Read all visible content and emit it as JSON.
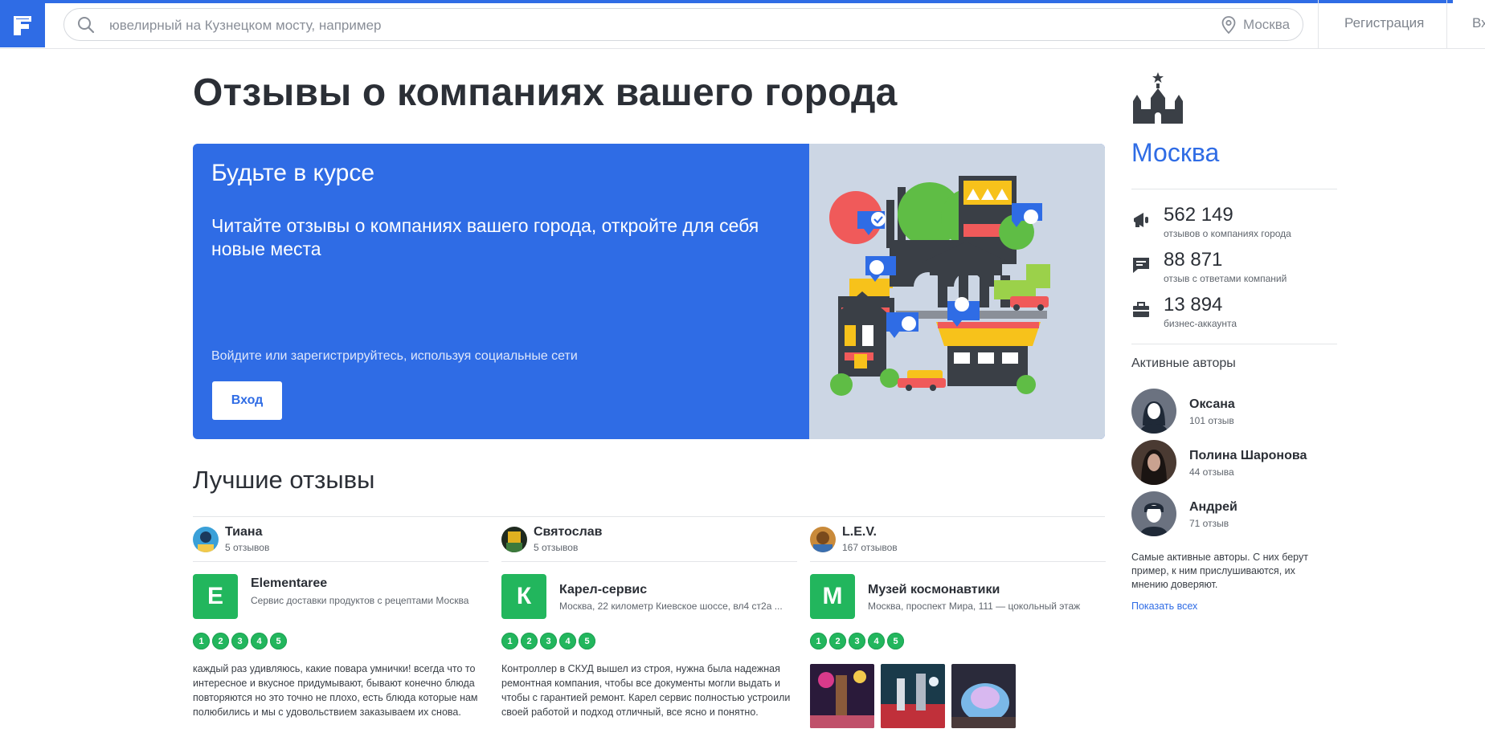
{
  "header": {
    "search_placeholder": "ювелирный на Кузнецком мосту, например",
    "city": "Москва",
    "register": "Регистрация",
    "login": "Вх"
  },
  "page": {
    "title": "Отзывы о компаниях вашего города"
  },
  "banner": {
    "title": "Будьте в курсе",
    "text": "Читайте отзывы о компаниях вашего города, откройте для себя новые места",
    "social": "Войдите или зарегистрируйтесь, используя социальные сети",
    "button": "Вход"
  },
  "best": {
    "title": "Лучшие отзывы",
    "cards": [
      {
        "author": "Тиана",
        "author_count": "5 отзывов",
        "letter": "E",
        "company": "Elementaree",
        "desc": "Сервис доставки продуктов с рецептами Москва",
        "rating": [
          "1",
          "2",
          "3",
          "4",
          "5"
        ],
        "text": "каждый раз удивляюсь, какие повара умнички! всегда что то интересное и вкусное придумывают, бывают конечно блюда повторяются но это точно не плохо, есть блюда которые нам полюбились и мы с удовольствием заказываем их снова."
      },
      {
        "author": "Святослав",
        "author_count": "5 отзывов",
        "letter": "К",
        "company": "Карел-сервис",
        "desc": "Москва, 22 километр Киевское шоссе, вл4 ст2а ...",
        "rating": [
          "1",
          "2",
          "3",
          "4",
          "5"
        ],
        "text": "Контроллер в СКУД вышел из строя, нужна была надежная ремонтная компания, чтобы все документы могли выдать и чтобы с гарантией ремонт. Карел сервис полностью устроили своей работой и подход отличный, все ясно и понятно."
      },
      {
        "author": "L.E.V.",
        "author_count": "167 отзывов",
        "letter": "М",
        "company": "Музей космонавтики",
        "desc": "Москва, проспект Мира, 111 — цокольный этаж",
        "rating": [
          "1",
          "2",
          "3",
          "4",
          "5"
        ]
      }
    ]
  },
  "sidebar": {
    "city": "Москва",
    "stats": [
      {
        "icon": "megaphone-icon",
        "value": "562 149",
        "label": "отзывов о компаниях города"
      },
      {
        "icon": "chat-icon",
        "value": "88 871",
        "label": "отзыв с ответами компаний"
      },
      {
        "icon": "briefcase-icon",
        "value": "13 894",
        "label": "бизнес-аккаунта"
      }
    ],
    "authors_title": "Активные авторы",
    "authors": [
      {
        "name": "Оксана",
        "count": "101 отзыв"
      },
      {
        "name": "Полина Шаронова",
        "count": "44 отзыва"
      },
      {
        "name": "Андрей",
        "count": "71 отзыв"
      }
    ],
    "note": "Самые активные авторы. С них берут пример, к ним прислушиваются, их мнению доверяют.",
    "show_all": "Показать всех"
  },
  "colors": {
    "accent": "#2f6ce5",
    "green": "#22b65d",
    "text": "#2b2f36"
  }
}
